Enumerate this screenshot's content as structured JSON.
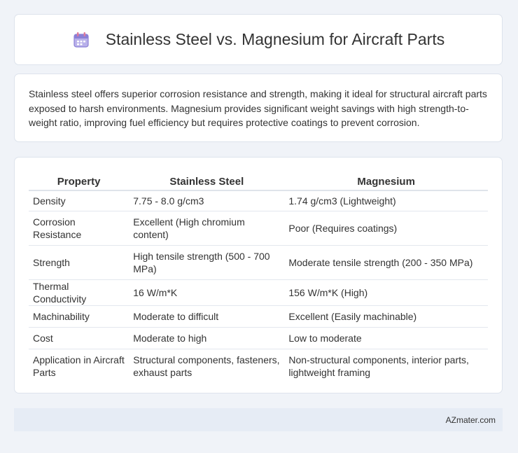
{
  "header": {
    "icon": "calendar-icon",
    "title": "Stainless Steel vs. Magnesium for Aircraft Parts"
  },
  "summary": {
    "text": "Stainless steel offers superior corrosion resistance and strength, making it ideal for structural aircraft parts exposed to harsh environments. Magnesium provides significant weight savings with high strength-to-weight ratio, improving fuel efficiency but requires protective coatings to prevent corrosion."
  },
  "table": {
    "headers": [
      "Property",
      "Stainless Steel",
      "Magnesium"
    ],
    "rows": [
      [
        "Density",
        "7.75 - 8.0 g/cm3",
        "1.74 g/cm3 (Lightweight)"
      ],
      [
        "Corrosion Resistance",
        "Excellent (High chromium content)",
        "Poor (Requires coatings)"
      ],
      [
        "Strength",
        "High tensile strength (500 - 700 MPa)",
        "Moderate tensile strength (200 - 350 MPa)"
      ],
      [
        "Thermal Conductivity",
        "16 W/m*K",
        "156 W/m*K (High)"
      ],
      [
        "Machinability",
        "Moderate to difficult",
        "Excellent (Easily machinable)"
      ],
      [
        "Cost",
        "Moderate to high",
        "Low to moderate"
      ],
      [
        "Application in Aircraft Parts",
        "Structural components, fasteners, exhaust parts",
        "Non-structural components, interior parts, lightweight framing"
      ]
    ]
  },
  "footer": {
    "text": "AZmater.com"
  },
  "colors": {
    "background": "#f0f3f8",
    "card": "#ffffff",
    "footer": "#e6ecf5",
    "icon_accent": "#8b7fd6"
  }
}
